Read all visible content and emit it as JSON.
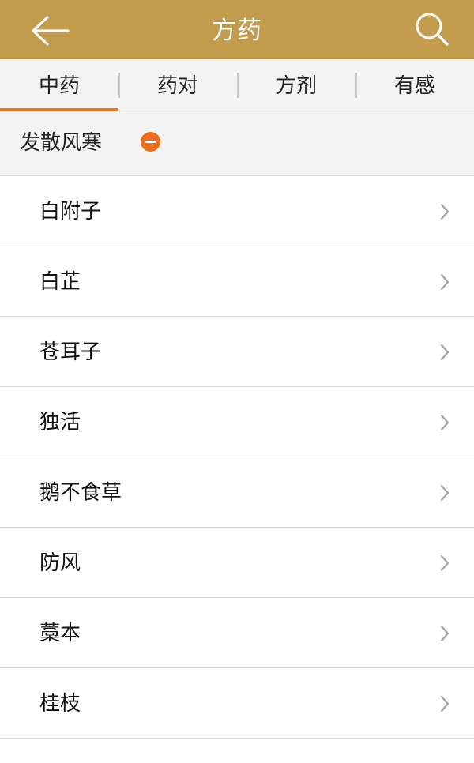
{
  "header": {
    "title": "方药",
    "back_icon": "arrow-left-icon",
    "search_icon": "search-icon",
    "background_color": "#c29b4d"
  },
  "tabs": [
    {
      "label": "中药",
      "active": true
    },
    {
      "label": "药对",
      "active": false
    },
    {
      "label": "方剂",
      "active": false
    },
    {
      "label": "有感",
      "active": false
    }
  ],
  "accent_color": "#e87722",
  "category": {
    "label": "发散风寒",
    "toggle_icon": "minus-circle-icon"
  },
  "items": [
    {
      "label": "白附子"
    },
    {
      "label": "白芷"
    },
    {
      "label": "苍耳子"
    },
    {
      "label": "独活"
    },
    {
      "label": "鹅不食草"
    },
    {
      "label": "防风"
    },
    {
      "label": "藁本"
    },
    {
      "label": "桂枝"
    }
  ]
}
